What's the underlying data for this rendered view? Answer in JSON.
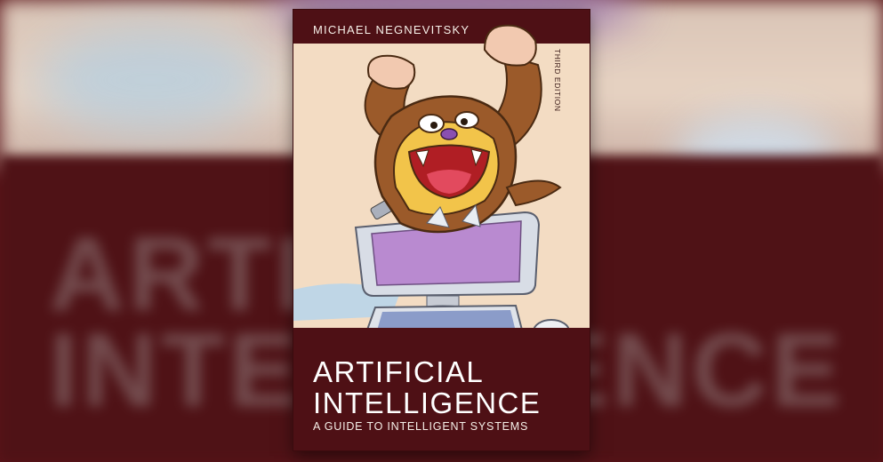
{
  "book": {
    "author": "MICHAEL NEGNEVITSKY",
    "edition": "THIRD EDITION",
    "title_line1": "ARTIFICIAL",
    "title_line2": "INTELLIGENCE",
    "subtitle": "A GUIDE TO INTELLIGENT SYSTEMS"
  },
  "backdrop": {
    "line1": "ARTI",
    "line2": "INTEL",
    "line3": "ENCE"
  },
  "colors": {
    "band": "#4e1015",
    "cover_bg": "#f3dcc3",
    "monster_fur": "#9b5a2a",
    "monster_face": "#f2c44a",
    "screen": "#b98ad0"
  }
}
